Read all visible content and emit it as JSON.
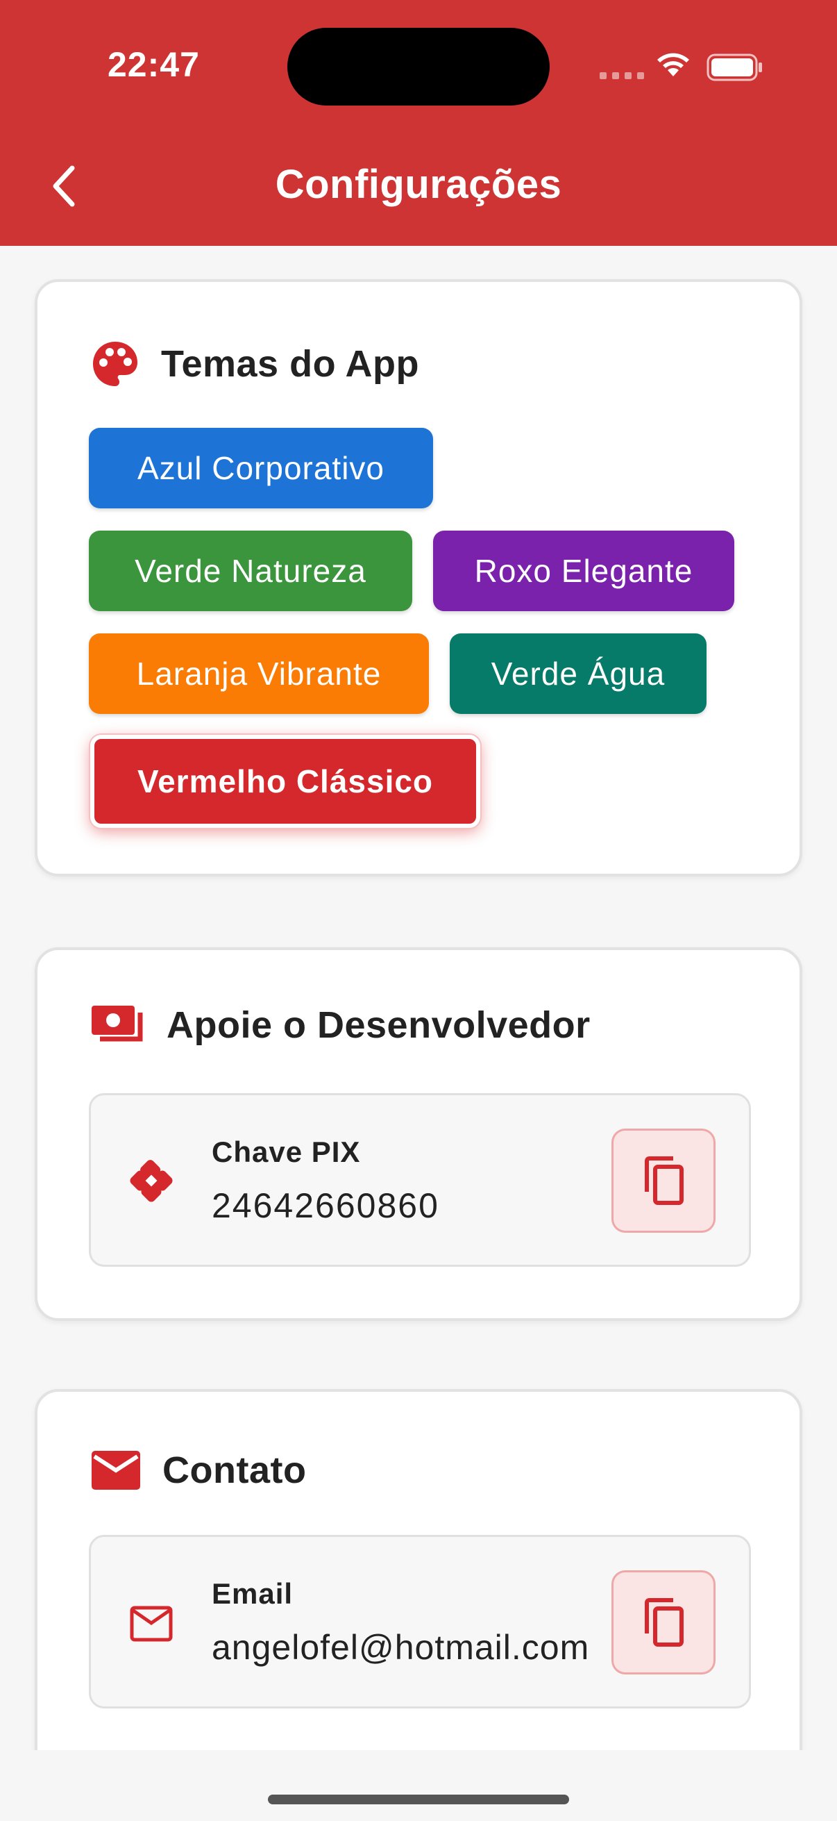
{
  "status_bar": {
    "time": "22:47"
  },
  "header": {
    "title": "Configurações"
  },
  "themes_card": {
    "title": "Temas do App",
    "themes": [
      {
        "label": "Azul Corporativo",
        "color": "#1e74d6"
      },
      {
        "label": "Verde Natureza",
        "color": "#3a953c"
      },
      {
        "label": "Roxo Elegante",
        "color": "#7a22ab"
      },
      {
        "label": "Laranja Vibrante",
        "color": "#fa7c05"
      },
      {
        "label": "Verde Água",
        "color": "#077b69"
      },
      {
        "label": "Vermelho Clássico",
        "color": "#d4282c",
        "selected": true
      }
    ]
  },
  "support_card": {
    "title": "Apoie o Desenvolvedor",
    "pix": {
      "label": "Chave PIX",
      "value": "24642660860"
    }
  },
  "contact_card": {
    "title": "Contato",
    "email": {
      "label": "Email",
      "value": "angelofel@hotmail.com"
    }
  },
  "colors": {
    "accent": "#cf3434"
  }
}
